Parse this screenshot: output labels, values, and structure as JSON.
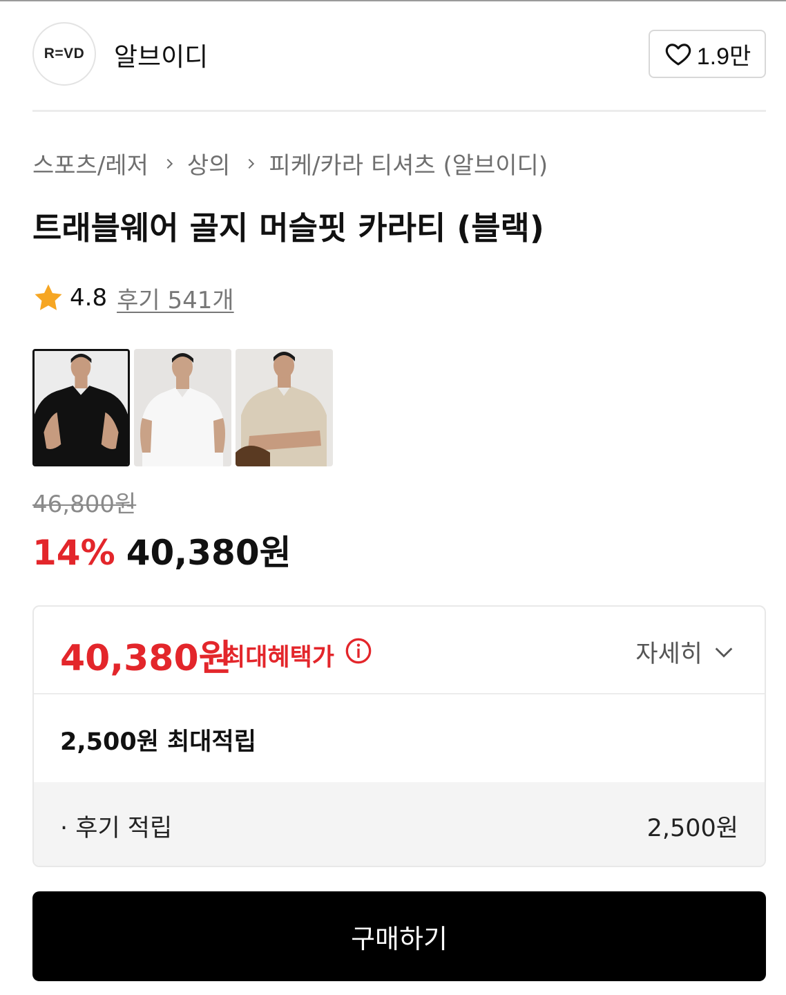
{
  "brand": {
    "logo_text": "R=VD",
    "name": "알브이디",
    "likes": "1.9만"
  },
  "breadcrumb": [
    "스포츠/레저",
    "상의",
    "피케/카라 티셔츠 (알브이디)"
  ],
  "product": {
    "title": "트래블웨어 골지 머슬핏 카라티 (블랙)",
    "rating": "4.8",
    "review_link": "후기 541개",
    "thumbnails": [
      {
        "color": "black",
        "selected": true
      },
      {
        "color": "white",
        "selected": false
      },
      {
        "color": "beige",
        "selected": false
      }
    ]
  },
  "pricing": {
    "original": "46,800원",
    "discount": "14%",
    "sale": "40,380원"
  },
  "benefits": {
    "max_price": "40,380원",
    "max_label": "최대혜택가",
    "detail_label": "자세히",
    "points_summary": "2,500원 최대적립",
    "review_point_label": "· 후기 적립",
    "review_point_value": "2,500원"
  },
  "cta": {
    "buy_label": "구매하기"
  },
  "colors": {
    "accent_red": "#e3262b",
    "star_orange": "#f6a623",
    "cta_bg": "#000000"
  }
}
